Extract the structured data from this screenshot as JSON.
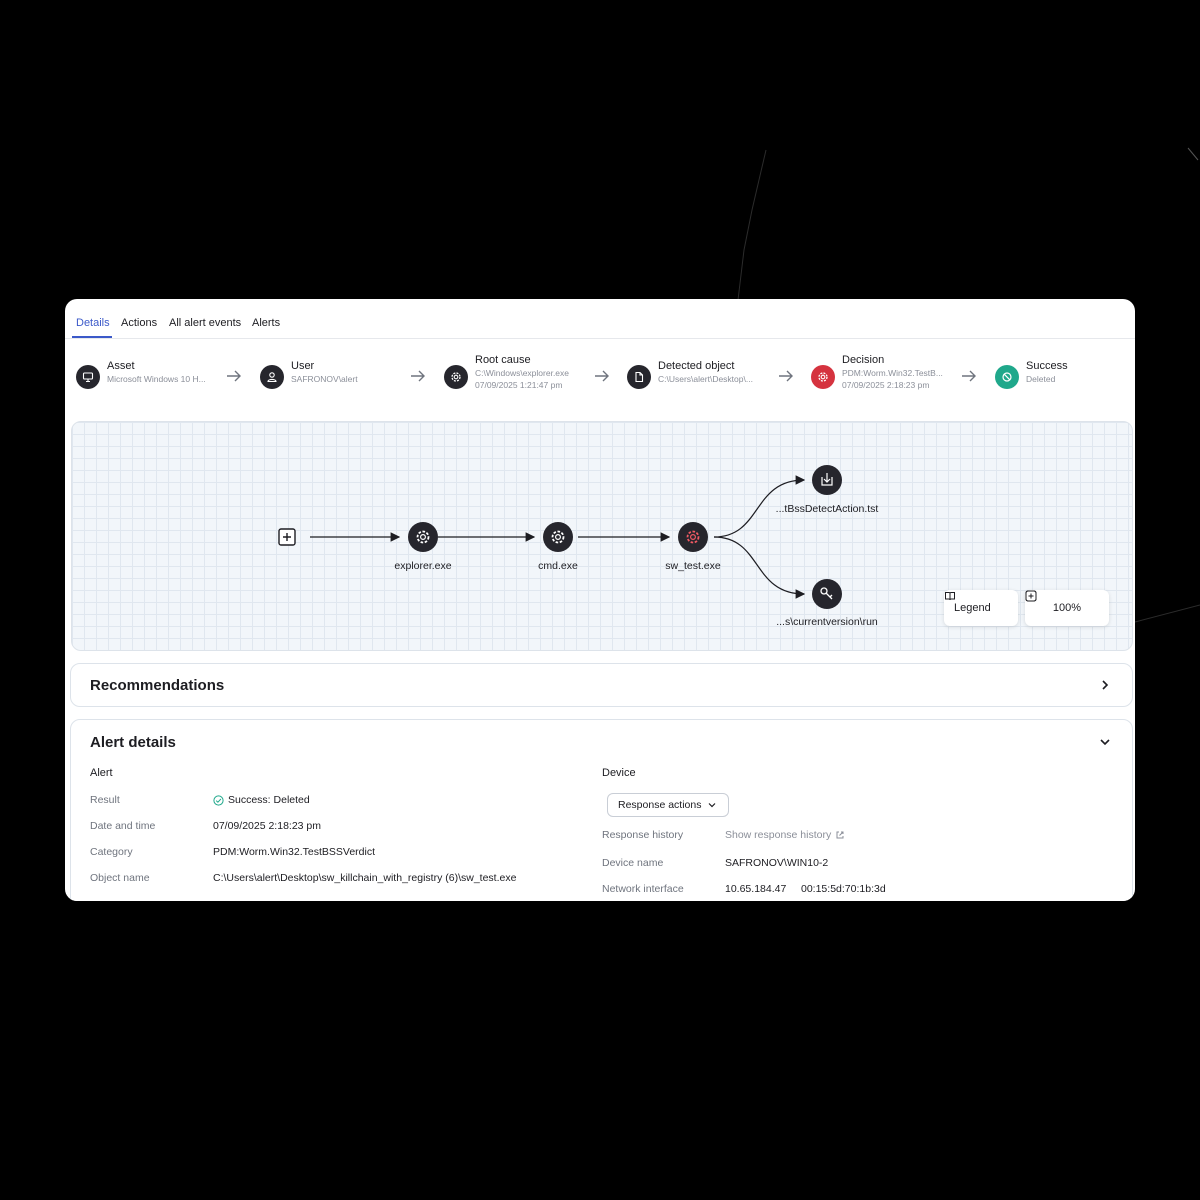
{
  "tabs": [
    {
      "label": "Details"
    },
    {
      "label": "Actions"
    },
    {
      "label": "All alert events"
    },
    {
      "label": "Alerts"
    }
  ],
  "chain": [
    {
      "title": "Asset",
      "sub1": "Microsoft Windows 10 H...",
      "sub2": "",
      "icon": "monitor-icon"
    },
    {
      "title": "User",
      "sub1": "SAFRONOV\\alert",
      "sub2": "",
      "icon": "user-icon"
    },
    {
      "title": "Root cause",
      "sub1": "C:\\Windows\\explorer.exe",
      "sub2": "07/09/2025 1:21:47 pm",
      "icon": "gear-icon"
    },
    {
      "title": "Detected object",
      "sub1": "C:\\Users\\alert\\Desktop\\...",
      "sub2": "",
      "icon": "file-icon"
    },
    {
      "title": "Decision",
      "sub1": "PDM:Worm.Win32.TestB...",
      "sub2": "07/09/2025 2:18:23 pm",
      "icon": "gear-icon"
    },
    {
      "title": "Success",
      "sub1": "Deleted",
      "sub2": "",
      "icon": "block-icon"
    }
  ],
  "graph": {
    "nodes": [
      {
        "label": "explorer.exe"
      },
      {
        "label": "cmd.exe"
      },
      {
        "label": "sw_test.exe"
      },
      {
        "label": "...tBssDetectAction.tst"
      },
      {
        "label": "...s\\currentversion\\run"
      }
    ],
    "legend_label": "Legend",
    "zoom_level": "100%"
  },
  "recommendations": {
    "title": "Recommendations"
  },
  "alert_details": {
    "title": "Alert details",
    "alert_section": "Alert",
    "device_section": "Device",
    "rows": [
      {
        "label": "Result",
        "value": "Success: Deleted"
      },
      {
        "label": "Date and time",
        "value": "07/09/2025 2:18:23 pm"
      },
      {
        "label": "Category",
        "value": "PDM:Worm.Win32.TestBSSVerdict"
      },
      {
        "label": "Object name",
        "value": "C:\\Users\\alert\\Desktop\\sw_killchain_with_registry (6)\\sw_test.exe"
      }
    ],
    "response_actions_label": "Response actions",
    "device_rows": [
      {
        "label": "Response history",
        "value": "Show response history"
      },
      {
        "label": "Device name",
        "value": "SAFRONOV\\WIN10-2"
      },
      {
        "label": "Network interface",
        "value": "10.65.184.47",
        "value2": "00:15:5d:70:1b:3d"
      }
    ]
  },
  "colors": {
    "accent": "#3b59c9",
    "danger": "#d5333f",
    "success": "#1fa88b",
    "node": "#26262d"
  }
}
